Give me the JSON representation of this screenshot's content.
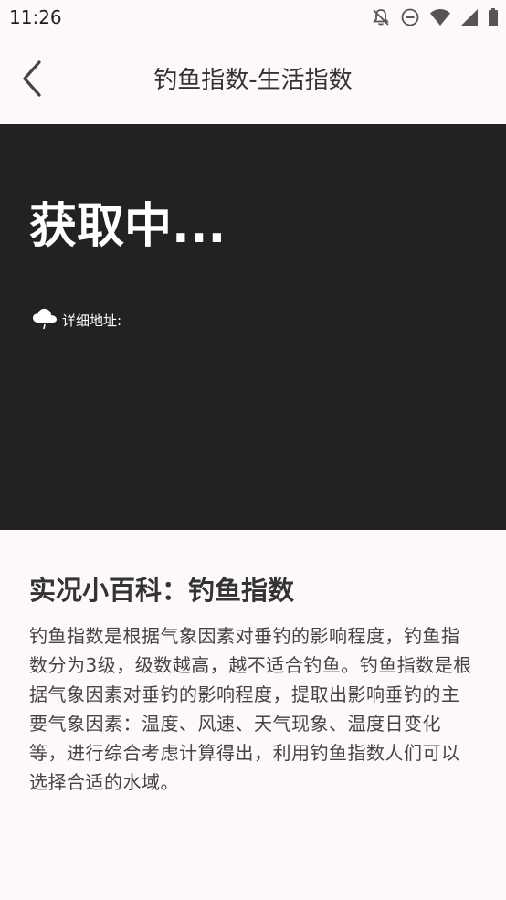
{
  "status_bar": {
    "time": "11:26",
    "icons": [
      "notifications-off-icon",
      "do-not-disturb-icon",
      "wifi-icon",
      "cellular-signal-icon",
      "battery-icon"
    ]
  },
  "app_bar": {
    "back_icon": "chevron-left-icon",
    "title": "钓鱼指数-生活指数"
  },
  "weather_panel": {
    "background": "#222222",
    "status_text": "获取中...",
    "address_icon": "cloud-rain-icon",
    "address_label": "详细地址:"
  },
  "encyclopedia": {
    "title": "实况小百科：钓鱼指数",
    "body": "钓鱼指数是根据气象因素对垂钓的影响程度，钓鱼指数分为3级，级数越高，越不适合钓鱼。钓鱼指数是根据气象因素对垂钓的影响程度，提取出影响垂钓的主要气象因素：温度、风速、天气现象、温度日变化等，进行综合考虑计算得出，利用钓鱼指数人们可以选择合适的水域。"
  }
}
